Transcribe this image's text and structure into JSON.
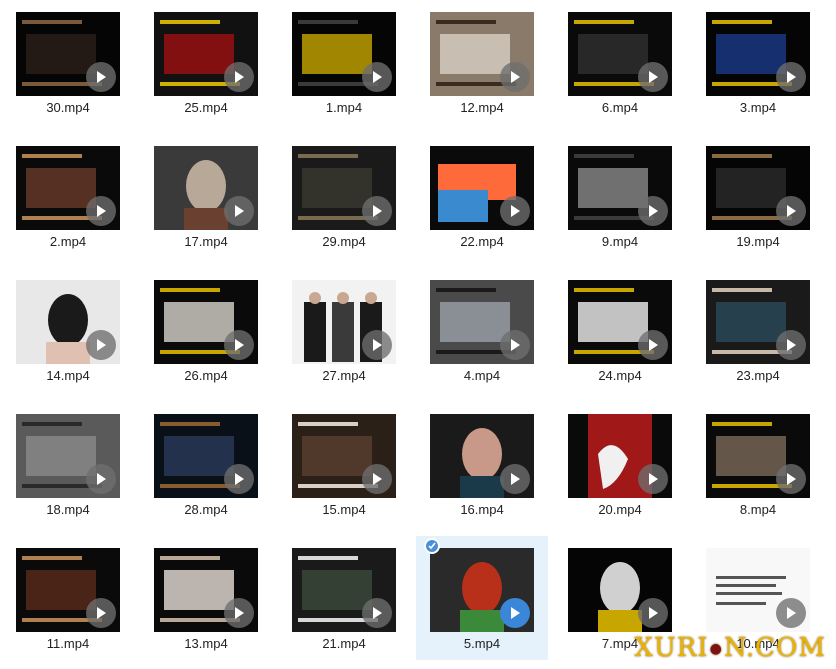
{
  "files": [
    {
      "name": "30.mp4",
      "icon": "play-icon",
      "thumb": "theater-seats",
      "colors": [
        "#050505",
        "#2a1f1a",
        "#7a5a3a"
      ]
    },
    {
      "name": "25.mp4",
      "icon": "play-icon",
      "thumb": "slide-red-text",
      "colors": [
        "#111111",
        "#a01010",
        "#d0b000"
      ]
    },
    {
      "name": "1.mp4",
      "icon": "play-icon",
      "thumb": "flowchart-yellow",
      "colors": [
        "#050505",
        "#c8a600",
        "#3a3a3a"
      ]
    },
    {
      "name": "12.mp4",
      "icon": "play-icon",
      "thumb": "horse-rider",
      "colors": [
        "#8a7a6a",
        "#d8d0c4",
        "#3a2a1f"
      ]
    },
    {
      "name": "6.mp4",
      "icon": "play-icon",
      "thumb": "dark-slide",
      "colors": [
        "#0a0a0a",
        "#2f2f2f",
        "#c8a600"
      ]
    },
    {
      "name": "3.mp4",
      "icon": "play-icon",
      "thumb": "color-space",
      "colors": [
        "#050505",
        "#1a3a8a",
        "#c8a600"
      ]
    },
    {
      "name": "2.mp4",
      "icon": "play-icon",
      "thumb": "costume-posters",
      "colors": [
        "#0a0a0a",
        "#6a3a2a",
        "#b08050"
      ]
    },
    {
      "name": "17.mp4",
      "icon": "play-icon",
      "thumb": "opera-portrait",
      "colors": [
        "#3a3a3a",
        "#b8a898",
        "#6a4030"
      ]
    },
    {
      "name": "29.mp4",
      "icon": "play-icon",
      "thumb": "officer-scene",
      "colors": [
        "#1a1a1a",
        "#3a3a30",
        "#7a6a50"
      ]
    },
    {
      "name": "22.mp4",
      "icon": "play-icon",
      "thumb": "resolution-bars",
      "colors": [
        "#0a0a0a",
        "#ff6a3a",
        "#3a8ad0"
      ]
    },
    {
      "name": "9.mp4",
      "icon": "play-icon",
      "thumb": "lighting-slide",
      "colors": [
        "#0a0a0a",
        "#8a8a8a",
        "#3a3a3a"
      ]
    },
    {
      "name": "19.mp4",
      "icon": "play-icon",
      "thumb": "dark-hand",
      "colors": [
        "#050505",
        "#2a2a2a",
        "#8a6a40"
      ]
    },
    {
      "name": "14.mp4",
      "icon": "play-icon",
      "thumb": "hanfu-portrait",
      "colors": [
        "#e8e8e8",
        "#1a1a1a",
        "#e0c0b0"
      ]
    },
    {
      "name": "26.mp4",
      "icon": "play-icon",
      "thumb": "notes-sheet",
      "colors": [
        "#0a0a0a",
        "#d8d4cc",
        "#c8a600"
      ]
    },
    {
      "name": "27.mp4",
      "icon": "play-icon",
      "thumb": "three-men",
      "colors": [
        "#f2f2f2",
        "#1a1a1a",
        "#3a3a3a"
      ]
    },
    {
      "name": "4.mp4",
      "icon": "play-icon",
      "thumb": "snow-warrior",
      "colors": [
        "#4a4a4a",
        "#9aa0a8",
        "#1a1a1a"
      ]
    },
    {
      "name": "24.mp4",
      "icon": "play-icon",
      "thumb": "text-document",
      "colors": [
        "#0a0a0a",
        "#f0f0f0",
        "#c8a600"
      ]
    },
    {
      "name": "23.mp4",
      "icon": "play-icon",
      "thumb": "editor-ui",
      "colors": [
        "#1a1a1a",
        "#2a4a5a",
        "#c8b8a8"
      ]
    },
    {
      "name": "18.mp4",
      "icon": "play-icon",
      "thumb": "temple-bw",
      "colors": [
        "#5a5a5a",
        "#8a8a8a",
        "#2a2a2a"
      ]
    },
    {
      "name": "28.mp4",
      "icon": "play-icon",
      "thumb": "night-scene",
      "colors": [
        "#0a1018",
        "#2a3a5a",
        "#8a5a30"
      ]
    },
    {
      "name": "15.mp4",
      "icon": "play-icon",
      "thumb": "interior-figure",
      "colors": [
        "#2a2018",
        "#5a4030",
        "#d8d0c8"
      ]
    },
    {
      "name": "16.mp4",
      "icon": "play-icon",
      "thumb": "qing-portrait",
      "colors": [
        "#1a1a1a",
        "#c89888",
        "#1a3a4a"
      ]
    },
    {
      "name": "20.mp4",
      "icon": "play-icon",
      "thumb": "teal-dancer",
      "colors": [
        "#1a8a8a",
        "#a01818",
        "#f0f0f0"
      ]
    },
    {
      "name": "8.mp4",
      "icon": "play-icon",
      "thumb": "collage-slide",
      "colors": [
        "#0a0a0a",
        "#7a6a5a",
        "#c8a600"
      ]
    },
    {
      "name": "11.mp4",
      "icon": "play-icon",
      "thumb": "banquet-scene",
      "colors": [
        "#0a0a0a",
        "#5a2a1a",
        "#b08050"
      ]
    },
    {
      "name": "13.mp4",
      "icon": "play-icon",
      "thumb": "white-dress",
      "colors": [
        "#0a0a0a",
        "#e8e0d8",
        "#b8a898"
      ]
    },
    {
      "name": "21.mp4",
      "icon": "play-icon",
      "thumb": "waterfall-ui",
      "colors": [
        "#1a1a1a",
        "#3a4a3a",
        "#d8d8d8"
      ]
    },
    {
      "name": "5.mp4",
      "icon": "play-icon",
      "thumb": "red-hair-portrait",
      "colors": [
        "#2a2a2a",
        "#b8301a",
        "#3a8a3a"
      ],
      "selected": true
    },
    {
      "name": "7.mp4",
      "icon": "play-icon",
      "thumb": "bw-face",
      "colors": [
        "#050505",
        "#d0d0d0",
        "#c8a600"
      ]
    },
    {
      "name": "10.mp4",
      "icon": "play-icon",
      "thumb": "white-text-page",
      "colors": [
        "#f8f8f8",
        "#1a1a1a",
        "#0a0a0a"
      ]
    }
  ],
  "watermark": {
    "left": "XURI",
    "mark": "●",
    "right": "N.COM"
  }
}
